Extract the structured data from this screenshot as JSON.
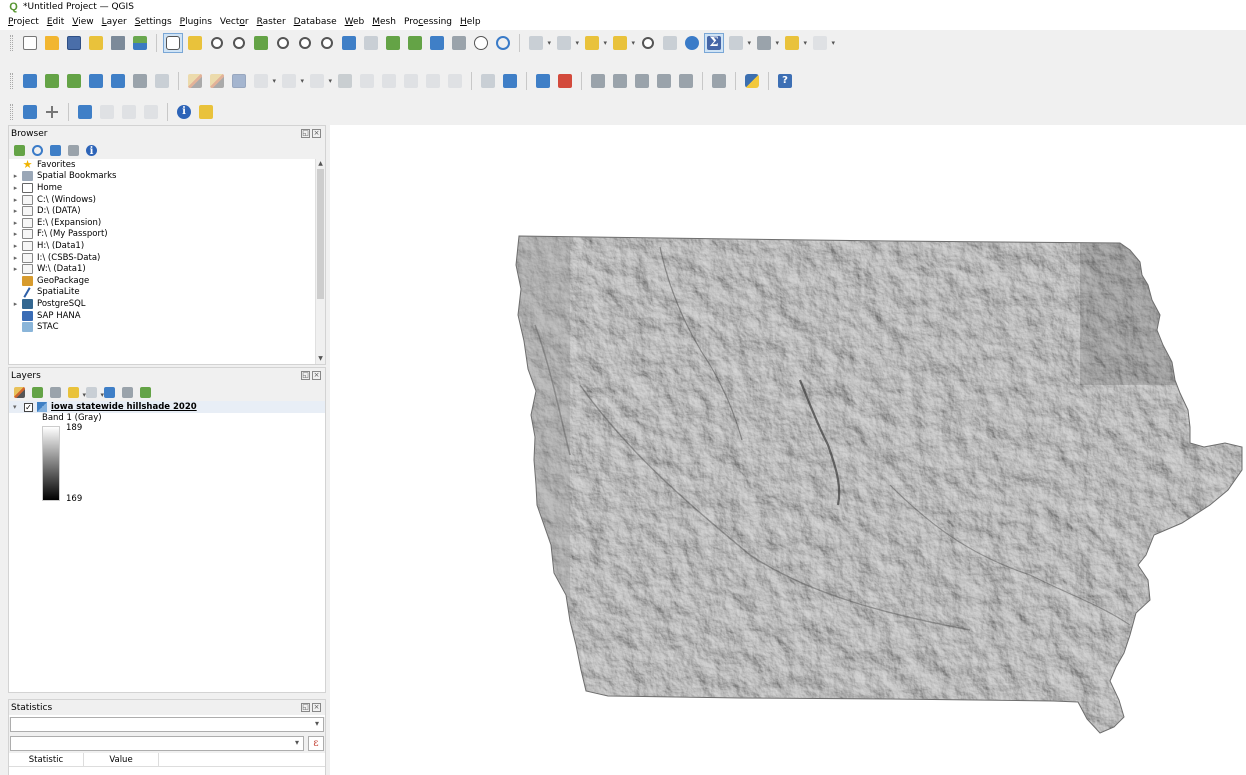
{
  "window": {
    "title": "*Untitled Project — QGIS"
  },
  "menu": [
    {
      "pre": "",
      "acc": "P",
      "post": "roject"
    },
    {
      "pre": "",
      "acc": "E",
      "post": "dit"
    },
    {
      "pre": "",
      "acc": "V",
      "post": "iew"
    },
    {
      "pre": "",
      "acc": "L",
      "post": "ayer"
    },
    {
      "pre": "",
      "acc": "S",
      "post": "ettings"
    },
    {
      "pre": "",
      "acc": "P",
      "post": "lugins"
    },
    {
      "pre": "Vect",
      "acc": "o",
      "post": "r"
    },
    {
      "pre": "",
      "acc": "R",
      "post": "aster"
    },
    {
      "pre": "",
      "acc": "D",
      "post": "atabase"
    },
    {
      "pre": "",
      "acc": "W",
      "post": "eb"
    },
    {
      "pre": "",
      "acc": "M",
      "post": "esh"
    },
    {
      "pre": "Pro",
      "acc": "c",
      "post": "essing"
    },
    {
      "pre": "",
      "acc": "H",
      "post": "elp"
    }
  ],
  "browser": {
    "title": "Browser",
    "items": [
      {
        "arrow": "",
        "icon": "star",
        "label": "Favorites"
      },
      {
        "arrow": "▸",
        "icon": "book",
        "label": "Spatial Bookmarks"
      },
      {
        "arrow": "▸",
        "icon": "home",
        "label": "Home"
      },
      {
        "arrow": "▸",
        "icon": "drive",
        "label": "C:\\ (Windows)"
      },
      {
        "arrow": "▸",
        "icon": "drive",
        "label": "D:\\ (DATA)"
      },
      {
        "arrow": "▸",
        "icon": "drive",
        "label": "E:\\ (Expansion)"
      },
      {
        "arrow": "▸",
        "icon": "drive",
        "label": "F:\\ (My Passport)"
      },
      {
        "arrow": "▸",
        "icon": "drive",
        "label": "H:\\ (Data1)"
      },
      {
        "arrow": "▸",
        "icon": "drive",
        "label": "I:\\ (CSBS-Data)"
      },
      {
        "arrow": "▸",
        "icon": "drive",
        "label": "W:\\ (Data1)"
      },
      {
        "arrow": "",
        "icon": "gpkg",
        "label": "GeoPackage"
      },
      {
        "arrow": "",
        "icon": "spatialite",
        "label": "SpatiaLite"
      },
      {
        "arrow": "▸",
        "icon": "pg",
        "label": "PostgreSQL"
      },
      {
        "arrow": "",
        "icon": "hana",
        "label": "SAP HANA"
      },
      {
        "arrow": "",
        "icon": "stac",
        "label": "STAC"
      }
    ]
  },
  "layers": {
    "title": "Layers",
    "layer_name": "iowa statewide hillshade 2020",
    "checked": "✓",
    "band": "Band 1 (Gray)",
    "max": "189",
    "min": "169"
  },
  "statistics": {
    "title": "Statistics",
    "col_statistic": "Statistic",
    "col_value": "Value",
    "epsilon": "ε"
  },
  "colors": {
    "qgis_green": "#589632",
    "hillshade_base": "#8a8a8a"
  }
}
